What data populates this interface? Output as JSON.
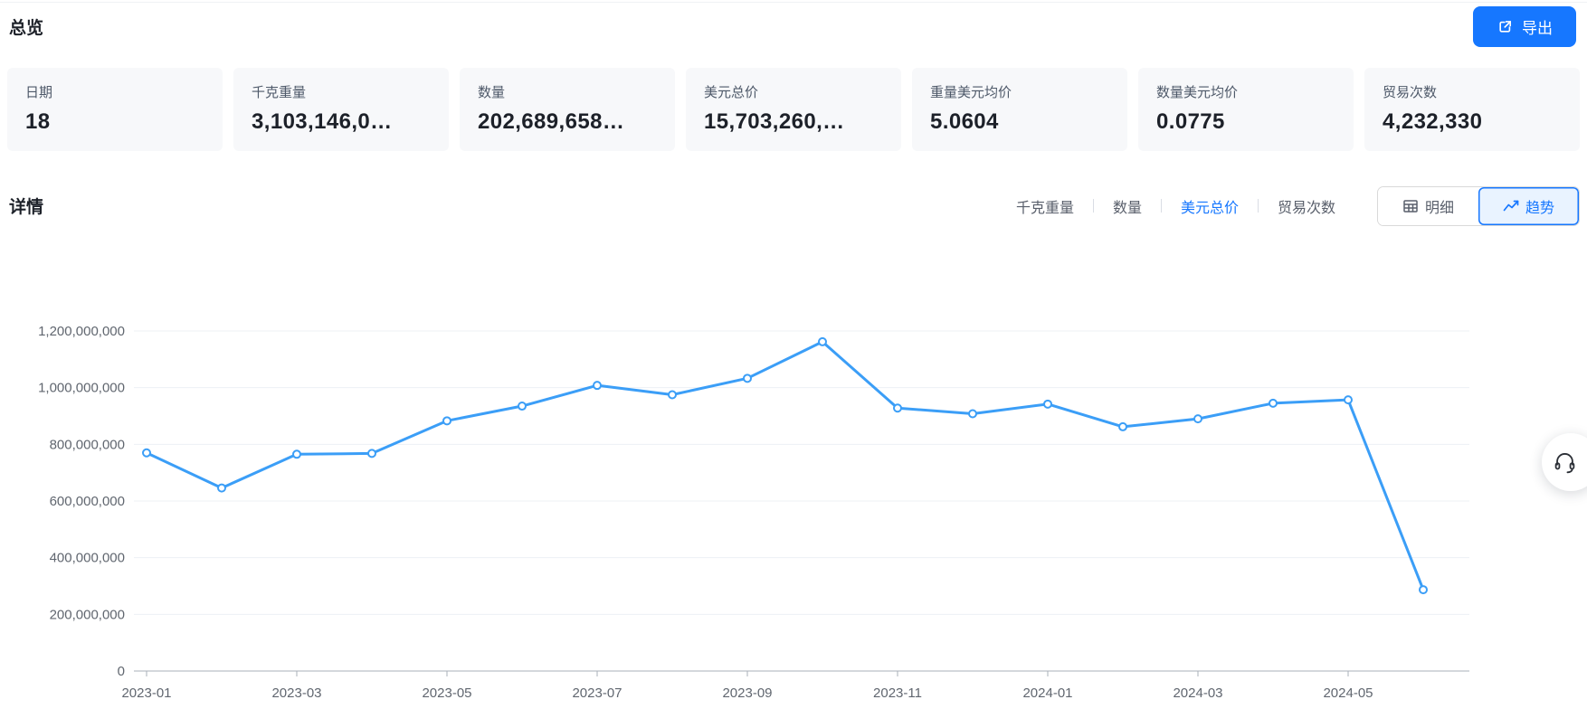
{
  "page": {
    "title": "总览",
    "details_title": "详情"
  },
  "export_button": {
    "label": "导出",
    "icon": "export-icon"
  },
  "stat_cards": [
    {
      "label": "日期",
      "value": "18"
    },
    {
      "label": "千克重量",
      "value": "3,103,146,0…"
    },
    {
      "label": "数量",
      "value": "202,689,658…"
    },
    {
      "label": "美元总价",
      "value": "15,703,260,…"
    },
    {
      "label": "重量美元均价",
      "value": "5.0604"
    },
    {
      "label": "数量美元均价",
      "value": "0.0775"
    },
    {
      "label": "贸易次数",
      "value": "4,232,330"
    }
  ],
  "metric_tabs": [
    {
      "label": "千克重量",
      "active": false
    },
    {
      "label": "数量",
      "active": false
    },
    {
      "label": "美元总价",
      "active": true
    },
    {
      "label": "贸易次数",
      "active": false
    }
  ],
  "view_toggle": [
    {
      "label": "明细",
      "icon": "table-icon",
      "active": false
    },
    {
      "label": "趋势",
      "icon": "trend-icon",
      "active": true
    }
  ],
  "support_button": {
    "icon": "headset-icon"
  },
  "colors": {
    "accent": "#1677ff",
    "accent_light_bg": "#e9f3ff",
    "chart_line": "#3b9ef7",
    "card_bg": "#f7f8fa",
    "text_primary": "#1d2129",
    "text_secondary": "#4e5969",
    "separator": "#d9dde4",
    "control_border": "#d9d9d9",
    "grid_line": "#edf0f5",
    "axis_line": "#aab0ba",
    "axis_text": "#60666f"
  },
  "chart_data": {
    "type": "line",
    "title": "",
    "series_name": "美元总价",
    "x": [
      "2023-01",
      "2023-02",
      "2023-03",
      "2023-04",
      "2023-05",
      "2023-06",
      "2023-07",
      "2023-08",
      "2023-09",
      "2023-10",
      "2023-11",
      "2023-12",
      "2024-01",
      "2024-02",
      "2024-03",
      "2024-04",
      "2024-05",
      "2024-06"
    ],
    "values": [
      770000000,
      646000000,
      765000000,
      768000000,
      883000000,
      935000000,
      1008000000,
      975000000,
      1033000000,
      1162000000,
      928000000,
      908000000,
      942000000,
      862000000,
      890000000,
      945000000,
      957000000,
      287000000
    ],
    "ylim": [
      0,
      1200000000
    ],
    "y_tick_step": 200000000,
    "x_label_every": 2,
    "grid": true,
    "legend": "none",
    "marker": "hollow-circle"
  }
}
